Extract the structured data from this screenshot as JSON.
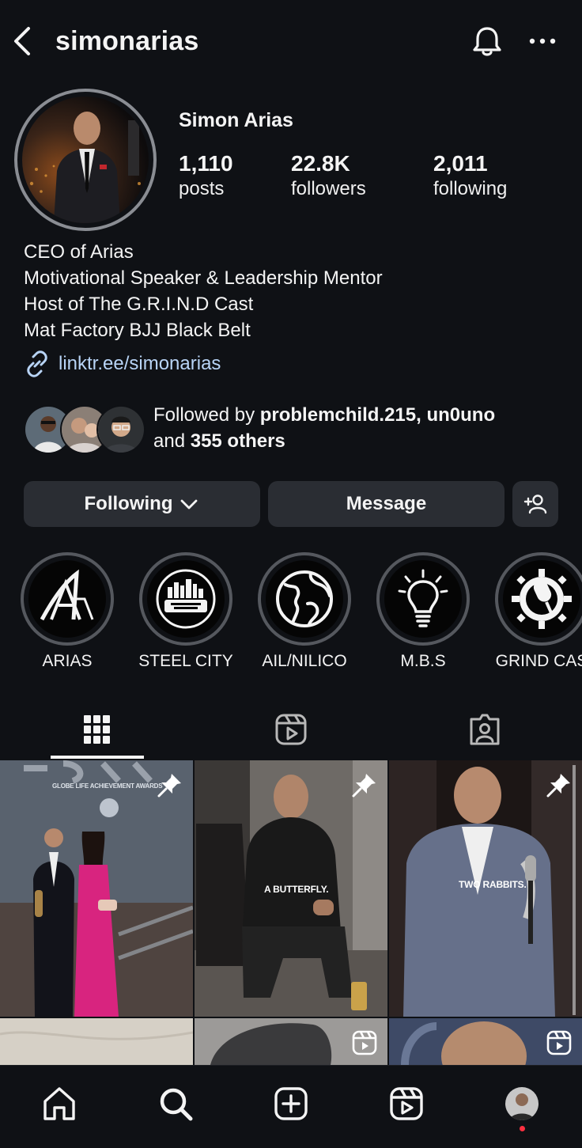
{
  "header": {
    "username": "simonarias",
    "back_icon": "chevron-left-icon",
    "bell_icon": "bell-icon",
    "more_icon": "more-horizontal-icon"
  },
  "profile": {
    "display_name": "Simon Arias",
    "stats": [
      {
        "value": "1,110",
        "label": "posts"
      },
      {
        "value": "22.8K",
        "label": "followers"
      },
      {
        "value": "2,011",
        "label": "following"
      }
    ],
    "bio_lines": [
      "CEO of Arias",
      "Motivational Speaker & Leadership Mentor",
      "Host of The G.R.I.N.D Cast",
      "Mat Factory BJJ Black Belt"
    ],
    "link": "linktr.ee/simonarias",
    "followed_by": {
      "prefix": "Followed by ",
      "names": "problemchild.215, un0uno",
      "and": "and ",
      "others": "355 others"
    }
  },
  "actions": {
    "following_label": "Following",
    "message_label": "Message"
  },
  "highlights": [
    {
      "label": "ARIAS",
      "icon": "arias-logo-icon"
    },
    {
      "label": "STEEL CITY",
      "icon": "steel-city-impact-icon"
    },
    {
      "label": "AIL/NILICO",
      "icon": "globe-icon"
    },
    {
      "label": "M.B.S",
      "icon": "lightbulb-icon"
    },
    {
      "label": "GRIND CAS",
      "icon": "microphone-gear-icon"
    }
  ],
  "posts": [
    {
      "pinned": true,
      "overlay": "GLOBE LIFE ACHIEVEMENT AWARDS"
    },
    {
      "pinned": true,
      "overlay": "A BUTTERFLY."
    },
    {
      "pinned": true,
      "overlay": "TWO RABBITS."
    }
  ],
  "colors": {
    "background": "#0f1115",
    "button": "#2a2d33",
    "link": "#b8d4f6",
    "notification_dot": "#ff3040"
  }
}
